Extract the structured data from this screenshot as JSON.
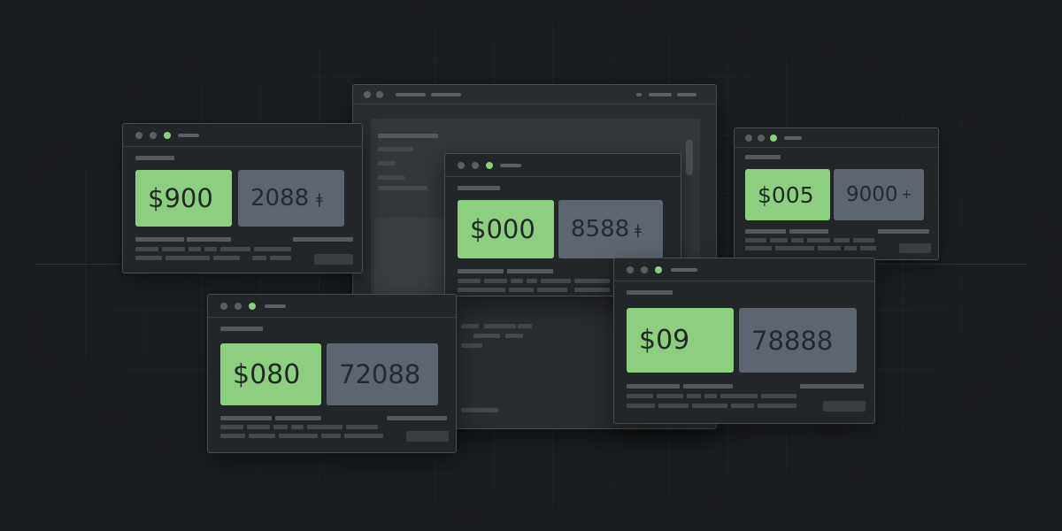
{
  "colors": {
    "background": "#1c1f22",
    "window": "#232629",
    "window_border": "#4a4e52",
    "price_card": "#8ccf7e",
    "number_card": "#5d6670",
    "active_dot": "#8ccf7e"
  },
  "windows": [
    {
      "price": "$900",
      "number": "2088",
      "number_icon": "ǂ"
    },
    {
      "price": "$000",
      "number": "8588",
      "number_icon": "ǂ"
    },
    {
      "price": "$005",
      "number": "9000",
      "number_icon": "+"
    },
    {
      "price": "$080",
      "number": "72088",
      "number_icon": ""
    },
    {
      "price": "$09",
      "number": "78888",
      "number_icon": ""
    }
  ]
}
